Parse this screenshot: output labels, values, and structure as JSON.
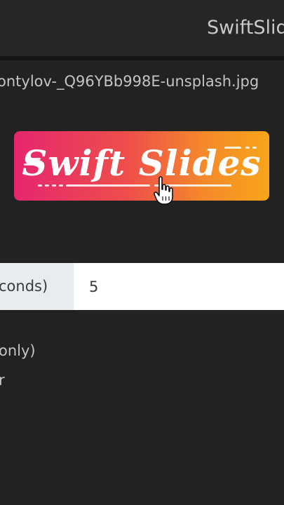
{
  "header": {
    "app_title": "SwiftSlid"
  },
  "file": {
    "name": "ontylov-_Q96YBb998E-unsplash.jpg"
  },
  "logo": {
    "text": "Swift Slides",
    "gradient_start": "#e5266f",
    "gradient_end": "#f7a51a"
  },
  "interval": {
    "label": "conds)",
    "value": "5"
  },
  "options": {
    "line1": "only)",
    "line2": "r"
  },
  "colors": {
    "background": "#222222",
    "titlebar": "#262626"
  }
}
